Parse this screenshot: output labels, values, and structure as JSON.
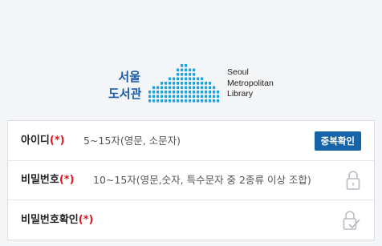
{
  "logo": {
    "ko_line1": "서울",
    "ko_line2": "도서관",
    "en_line1": "Seoul",
    "en_line2": "Metropolitan",
    "en_line3": "Library",
    "colors": {
      "brand_blue": "#1a5ba8",
      "mark_dot": "#1fa3dc"
    }
  },
  "form": {
    "id_row": {
      "label": "아이디",
      "required_mark": "(*)",
      "placeholder": "5~15자(영문, 소문자)",
      "check_button": "중복확인"
    },
    "password_row": {
      "label": "비밀번호",
      "required_mark": "(*)",
      "placeholder": "10~15자(영문,숫자, 특수문자 중 2종류 이상 조합)",
      "icon": "lock-icon"
    },
    "password_confirm_row": {
      "label": "비밀번호확인",
      "required_mark": "(*)",
      "icon": "lock-check-icon"
    },
    "colors": {
      "button_blue": "#1565a8",
      "required_red": "#e0141e"
    }
  }
}
